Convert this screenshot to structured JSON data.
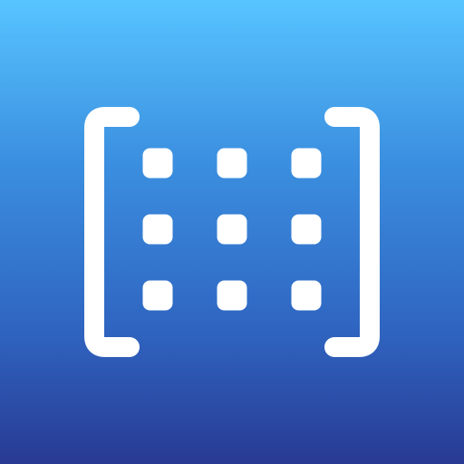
{
  "icon": {
    "semantic": "matrix-brackets-grid-icon",
    "grid": {
      "rows": 3,
      "columns": 3
    },
    "colors": {
      "gradient_top": "#57c4ff",
      "gradient_bottom": "#283a93",
      "glyph": "#ffffff"
    }
  }
}
